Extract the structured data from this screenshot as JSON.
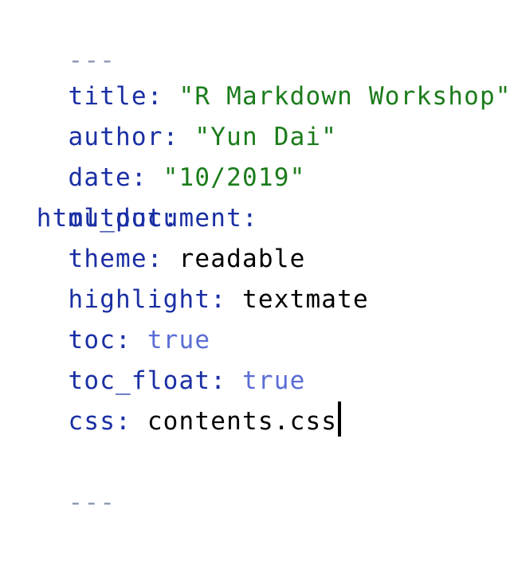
{
  "editor": {
    "lines": [
      {
        "tokens": [
          {
            "type": "dash",
            "text": "---"
          }
        ]
      },
      {
        "tokens": [
          {
            "type": "key",
            "text": "title:"
          },
          {
            "type": "str",
            "text": "\"R Markdown Workshop\""
          }
        ]
      },
      {
        "tokens": [
          {
            "type": "key",
            "text": "author:"
          },
          {
            "type": "str",
            "text": "\"Yun Dai\""
          }
        ]
      },
      {
        "tokens": [
          {
            "type": "key",
            "text": "date:"
          },
          {
            "type": "str",
            "text": "\"10/2019\""
          }
        ]
      },
      {
        "tokens": [
          {
            "type": "key",
            "text": "output:"
          }
        ]
      },
      {
        "tokens": [
          {
            "type": "key",
            "text": "html_document:"
          }
        ]
      },
      {
        "tokens": [
          {
            "type": "key",
            "text": "theme:"
          },
          {
            "type": "plain",
            "text": "readable"
          }
        ]
      },
      {
        "tokens": [
          {
            "type": "key",
            "text": "highlight:"
          },
          {
            "type": "plain",
            "text": "textmate"
          }
        ]
      },
      {
        "tokens": [
          {
            "type": "key",
            "text": "toc:"
          },
          {
            "type": "bool",
            "text": "true"
          }
        ]
      },
      {
        "tokens": [
          {
            "type": "key",
            "text": "toc_float:"
          },
          {
            "type": "bool",
            "text": "true"
          }
        ]
      },
      {
        "tokens": [
          {
            "type": "key",
            "text": "css:"
          },
          {
            "type": "plain",
            "text": "contents.css"
          }
        ]
      },
      {
        "tokens": [
          {
            "type": "dash",
            "text": "---"
          }
        ]
      }
    ]
  }
}
